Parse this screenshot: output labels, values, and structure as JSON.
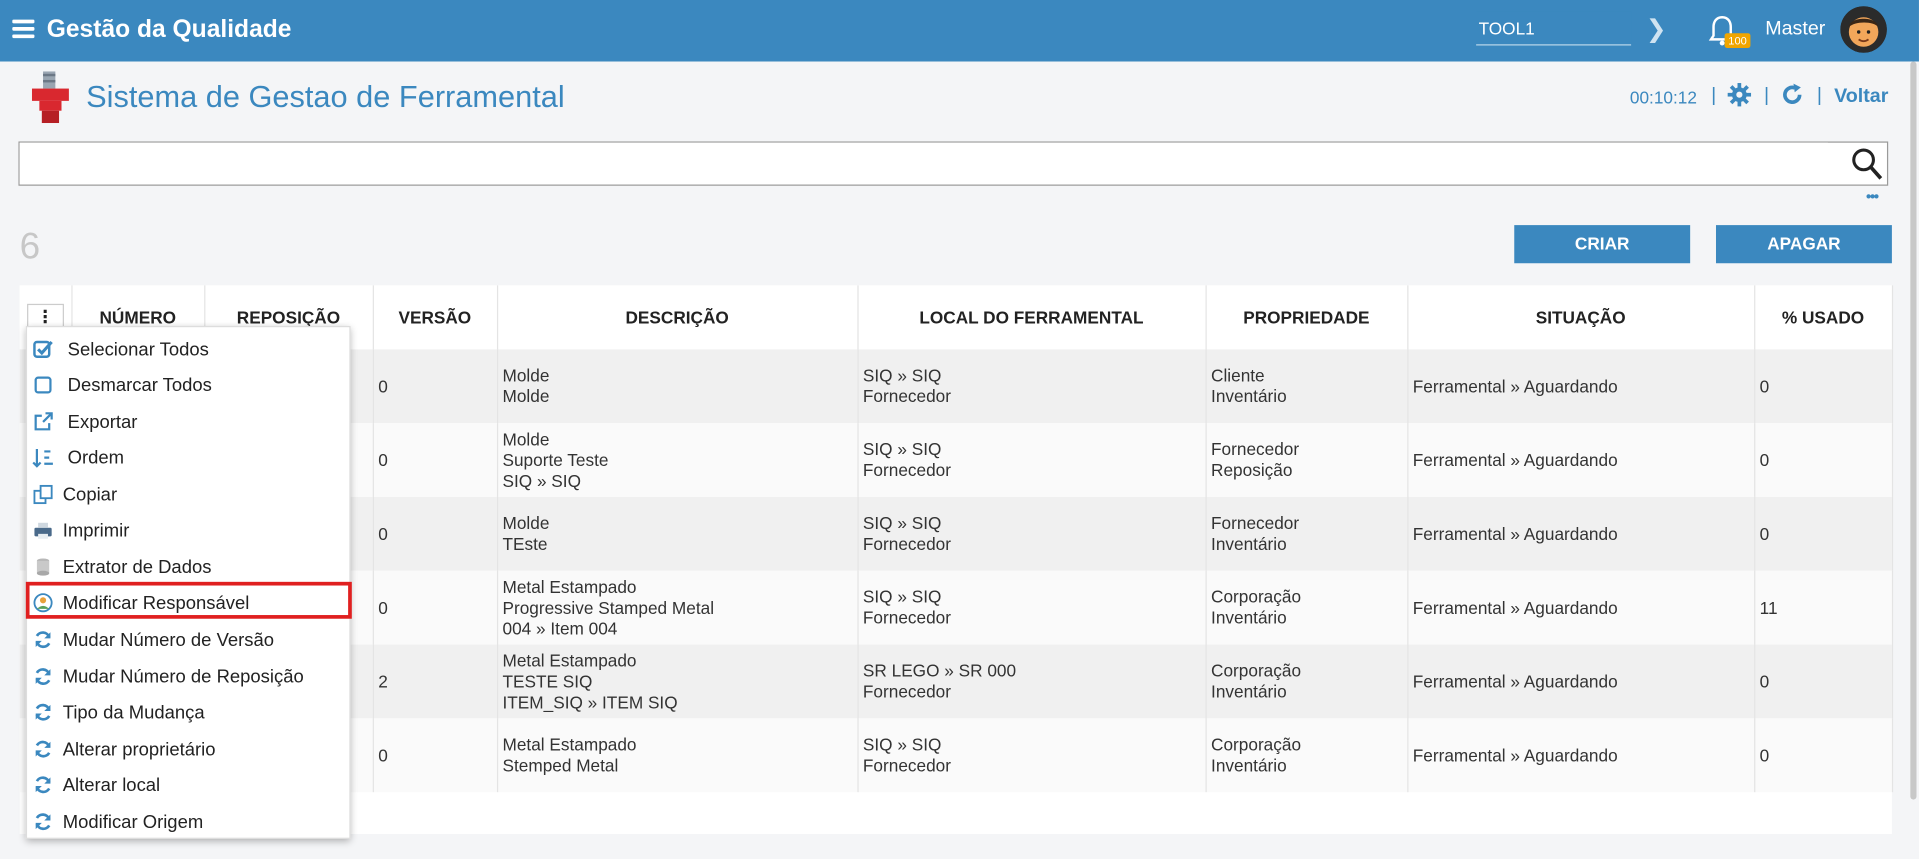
{
  "app": {
    "title": "Gestão da Qualidade",
    "tool_value": "TOOL1",
    "notification_count": "100",
    "user": "Master"
  },
  "page": {
    "title": "Sistema de Gestao de Ferramental",
    "timer": "00:10:12",
    "back_label": "Voltar",
    "separator": "|"
  },
  "search": {
    "placeholder": "",
    "more": "•••"
  },
  "toolbar": {
    "count": "6",
    "create_label": "CRIAR",
    "delete_label": "APAGAR"
  },
  "table": {
    "columns": [
      "NÚMERO",
      "REPOSIÇÃO",
      "VERSÃO",
      "DESCRIÇÃO",
      "LOCAL DO FERRAMENTAL",
      "PROPRIEDADE",
      "SITUAÇÃO",
      "% USADO"
    ],
    "rows": [
      {
        "versao": "0",
        "descricao": [
          "Molde",
          "Molde"
        ],
        "local": [
          "SIQ » SIQ",
          "Fornecedor"
        ],
        "propriedade": [
          "Cliente",
          "Inventário"
        ],
        "situacao": "Ferramental » Aguardando",
        "usado": "0"
      },
      {
        "versao": "0",
        "descricao": [
          "Molde",
          "Suporte Teste",
          "SIQ » SIQ"
        ],
        "local": [
          "SIQ » SIQ",
          "Fornecedor"
        ],
        "propriedade": [
          "Fornecedor",
          "Reposição"
        ],
        "situacao": "Ferramental » Aguardando",
        "usado": "0"
      },
      {
        "versao": "0",
        "descricao": [
          "Molde",
          "TEste"
        ],
        "local": [
          "SIQ » SIQ",
          "Fornecedor"
        ],
        "propriedade": [
          "Fornecedor",
          "Inventário"
        ],
        "situacao": "Ferramental » Aguardando",
        "usado": "0"
      },
      {
        "versao": "0",
        "descricao": [
          "Metal Estampado",
          "Progressive Stamped Metal",
          "004 » Item 004"
        ],
        "local": [
          "SIQ » SIQ",
          "Fornecedor"
        ],
        "propriedade": [
          "Corporação",
          "Inventário"
        ],
        "situacao": "Ferramental » Aguardando",
        "usado": "11"
      },
      {
        "versao": "2",
        "descricao": [
          "Metal Estampado",
          "TESTE SIQ",
          "ITEM_SIQ » ITEM SIQ"
        ],
        "local": [
          "SR LEGO » SR 000",
          "Fornecedor"
        ],
        "propriedade": [
          "Corporação",
          "Inventário"
        ],
        "situacao": "Ferramental » Aguardando",
        "usado": "0"
      },
      {
        "versao": "0",
        "descricao": [
          "Metal Estampado",
          "Stemped Metal"
        ],
        "local": [
          "SIQ » SIQ",
          "Fornecedor"
        ],
        "propriedade": [
          "Corporação",
          "Inventário"
        ],
        "situacao": "Ferramental » Aguardando",
        "usado": "0"
      }
    ]
  },
  "menu": {
    "items": [
      {
        "label": "Selecionar Todos",
        "icon": "checkbox-checked-icon"
      },
      {
        "label": "Desmarcar Todos",
        "icon": "checkbox-empty-icon"
      },
      {
        "label": "Exportar",
        "icon": "export-icon"
      },
      {
        "label": "Ordem",
        "icon": "sort-icon"
      },
      {
        "label": "Copiar",
        "icon": "copy-icon"
      },
      {
        "label": "Imprimir",
        "icon": "printer-icon"
      },
      {
        "label": "Extrator de Dados",
        "icon": "database-icon"
      },
      {
        "label": "Modificar Responsável",
        "icon": "responsible-icon"
      },
      {
        "label": "Mudar Número de Versão",
        "icon": "refresh-icon"
      },
      {
        "label": "Mudar Número de Reposição",
        "icon": "refresh-icon"
      },
      {
        "label": "Tipo da Mudança",
        "icon": "refresh-icon"
      },
      {
        "label": "Alterar proprietário",
        "icon": "refresh-icon"
      },
      {
        "label": "Alterar local",
        "icon": "refresh-icon"
      },
      {
        "label": "Modificar Origem",
        "icon": "refresh-icon"
      }
    ]
  },
  "colors": {
    "primary": "#3b88bf",
    "highlight": "#e02020",
    "badge": "#f0a500"
  }
}
